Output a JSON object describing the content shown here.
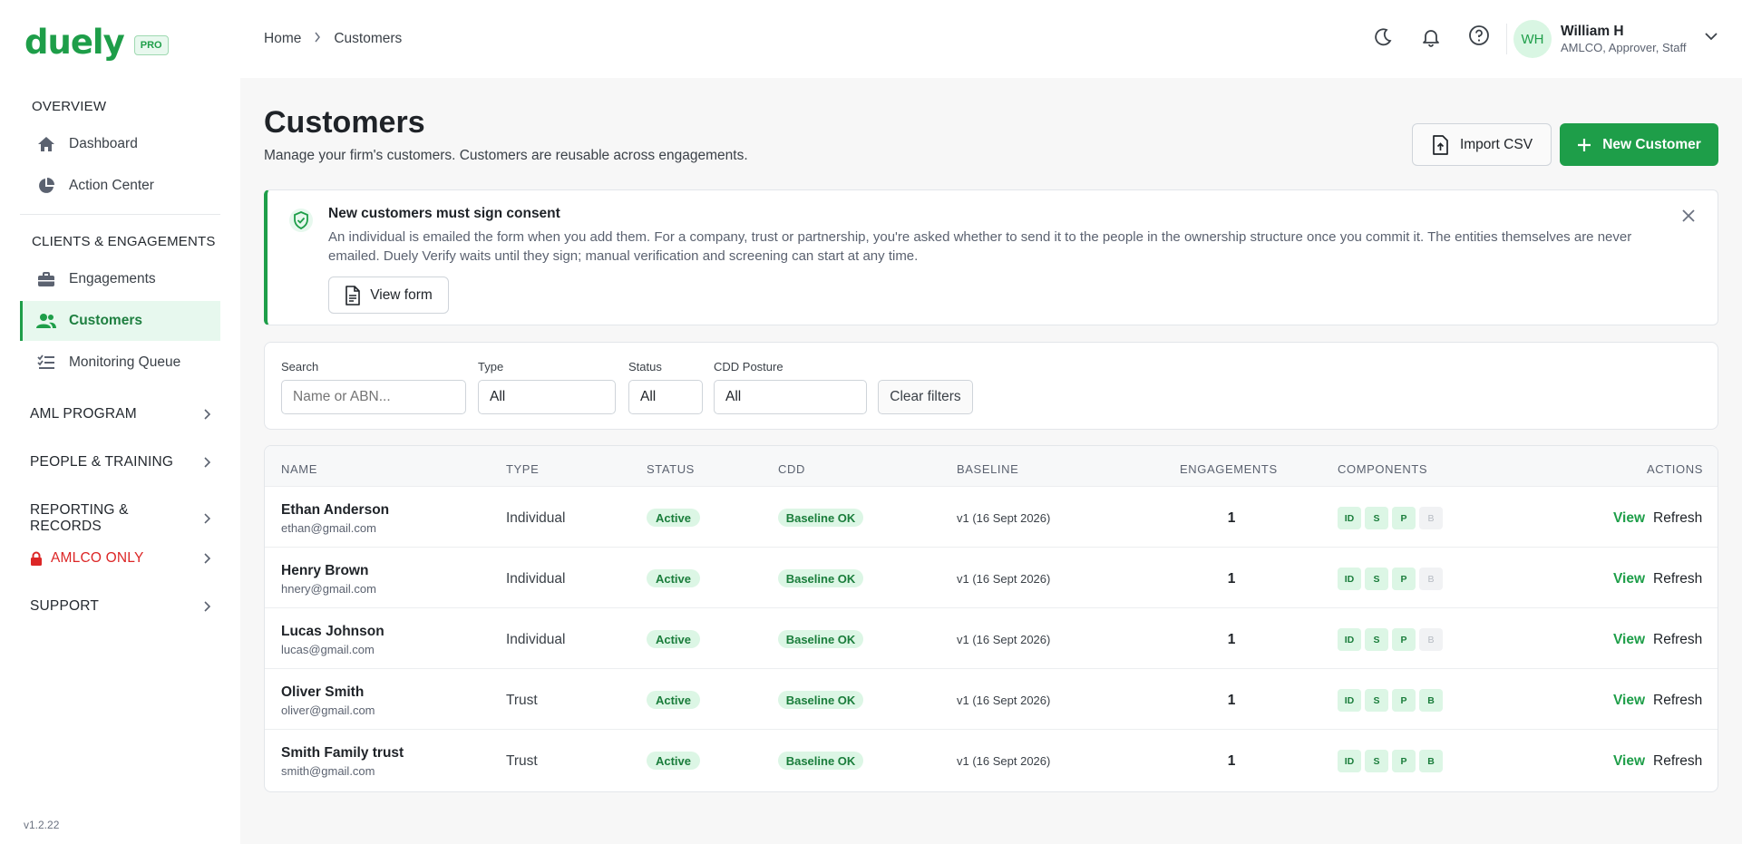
{
  "brand": {
    "logo": "duely",
    "badge": "PRO",
    "version": "v1.2.22"
  },
  "sidebar": {
    "sections": [
      {
        "heading": "OVERVIEW",
        "items": [
          {
            "label": "Dashboard",
            "icon": "home-icon"
          },
          {
            "label": "Action Center",
            "icon": "pie-chart-icon"
          }
        ]
      },
      {
        "heading": "CLIENTS & ENGAGEMENTS",
        "items": [
          {
            "label": "Engagements",
            "icon": "briefcase-icon"
          },
          {
            "label": "Customers",
            "icon": "users-icon",
            "active": true
          },
          {
            "label": "Monitoring Queue",
            "icon": "checklist-icon"
          }
        ]
      }
    ],
    "groups": [
      {
        "label": "AML PROGRAM"
      },
      {
        "label": "PEOPLE & TRAINING"
      },
      {
        "label": "REPORTING & RECORDS"
      },
      {
        "label": "AMLCO ONLY",
        "icon": "lock-icon",
        "color": "#dc2626"
      },
      {
        "label": "SUPPORT"
      }
    ]
  },
  "topbar": {
    "breadcrumb": [
      "Home",
      "Customers"
    ],
    "user": {
      "initials": "WH",
      "name": "William H",
      "role": "AMLCO, Approver, Staff"
    }
  },
  "page": {
    "title": "Customers",
    "subtitle": "Manage your firm's customers. Customers are reusable across engagements.",
    "import_label": "Import CSV",
    "new_label": "New Customer"
  },
  "notice": {
    "title": "New customers must sign consent",
    "body": "An individual is emailed the form when you add them. For a company, trust or partnership, you're asked whether to send it to the people in the ownership structure once you commit it. The entities themselves are never emailed. Duely Verify waits until they sign; manual verification and screening can start at any time.",
    "button": "View form"
  },
  "filters": {
    "search_label": "Search",
    "search_placeholder": "Name or ABN...",
    "type_label": "Type",
    "type_value": "All",
    "status_label": "Status",
    "status_value": "All",
    "cdd_label": "CDD Posture",
    "cdd_value": "All",
    "clear_label": "Clear filters"
  },
  "table": {
    "columns": [
      "NAME",
      "TYPE",
      "STATUS",
      "CDD",
      "BASELINE",
      "ENGAGEMENTS",
      "COMPONENTS",
      "ACTIONS"
    ],
    "rows": [
      {
        "name": "Ethan Anderson",
        "email": "ethan@gmail.com",
        "type": "Individual",
        "status": "Active",
        "cdd": "Baseline OK",
        "baseline": "v1 (16 Sept 2026)",
        "engagements": "1",
        "components": [
          {
            "k": "ID",
            "on": true
          },
          {
            "k": "S",
            "on": true
          },
          {
            "k": "P",
            "on": true
          },
          {
            "k": "B",
            "on": false
          }
        ],
        "view": "View",
        "refresh": "Refresh"
      },
      {
        "name": "Henry Brown",
        "email": "hnery@gmail.com",
        "type": "Individual",
        "status": "Active",
        "cdd": "Baseline OK",
        "baseline": "v1 (16 Sept 2026)",
        "engagements": "1",
        "components": [
          {
            "k": "ID",
            "on": true
          },
          {
            "k": "S",
            "on": true
          },
          {
            "k": "P",
            "on": true
          },
          {
            "k": "B",
            "on": false
          }
        ],
        "view": "View",
        "refresh": "Refresh"
      },
      {
        "name": "Lucas Johnson",
        "email": "lucas@gmail.com",
        "type": "Individual",
        "status": "Active",
        "cdd": "Baseline OK",
        "baseline": "v1 (16 Sept 2026)",
        "engagements": "1",
        "components": [
          {
            "k": "ID",
            "on": true
          },
          {
            "k": "S",
            "on": true
          },
          {
            "k": "P",
            "on": true
          },
          {
            "k": "B",
            "on": false
          }
        ],
        "view": "View",
        "refresh": "Refresh"
      },
      {
        "name": "Oliver Smith",
        "email": "oliver@gmail.com",
        "type": "Trust",
        "status": "Active",
        "cdd": "Baseline OK",
        "baseline": "v1 (16 Sept 2026)",
        "engagements": "1",
        "components": [
          {
            "k": "ID",
            "on": true
          },
          {
            "k": "S",
            "on": true
          },
          {
            "k": "P",
            "on": true
          },
          {
            "k": "B",
            "on": true
          }
        ],
        "view": "View",
        "refresh": "Refresh"
      },
      {
        "name": "Smith Family trust",
        "email": "smith@gmail.com",
        "type": "Trust",
        "status": "Active",
        "cdd": "Baseline OK",
        "baseline": "v1 (16 Sept 2026)",
        "engagements": "1",
        "components": [
          {
            "k": "ID",
            "on": true
          },
          {
            "k": "S",
            "on": true
          },
          {
            "k": "P",
            "on": true
          },
          {
            "k": "B",
            "on": true
          }
        ],
        "view": "View",
        "refresh": "Refresh"
      }
    ]
  },
  "colors": {
    "brand": "#1e9e49",
    "danger": "#dc2626"
  }
}
